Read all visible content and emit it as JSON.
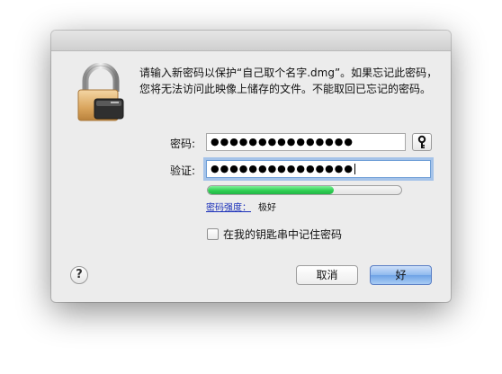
{
  "dialog": {
    "message": "请输入新密码以保护“自己取个名字.dmg”。如果忘记此密码，您将无法访问此映像上储存的文件。不能取回已忘记的密码。",
    "lock_icon": "lock-icon"
  },
  "password": {
    "label": "密码:",
    "value": "●●●●●●●●●●●●●●●"
  },
  "verify": {
    "label": "验证:",
    "value": "●●●●●●●●●●●●●●●"
  },
  "key_button": {
    "icon": "key-icon"
  },
  "strength": {
    "link": "密码强度：",
    "value": "极好",
    "level": 0.65,
    "color": "#2fcf52"
  },
  "keychain": {
    "label": "在我的钥匙串中记住密码",
    "checked": false
  },
  "help": {
    "label": "?"
  },
  "buttons": {
    "cancel": "取消",
    "ok": "好"
  },
  "colors": {
    "accent": "#6ea3e6",
    "link": "#1a2fb9"
  }
}
